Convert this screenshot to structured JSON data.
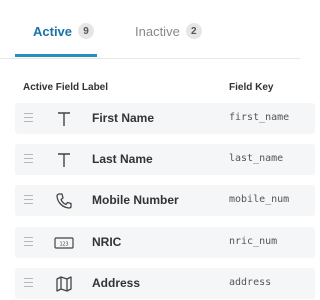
{
  "tabs": [
    {
      "label": "Active",
      "count": "9",
      "selected": true
    },
    {
      "label": "Inactive",
      "count": "2",
      "selected": false
    }
  ],
  "table": {
    "columns": {
      "label": "Active Field Label",
      "key": "Field Key"
    },
    "rows": [
      {
        "icon": "text-icon",
        "label": "First Name",
        "key": "first_name"
      },
      {
        "icon": "text-icon",
        "label": "Last Name",
        "key": "last_name"
      },
      {
        "icon": "phone-icon",
        "label": "Mobile Number",
        "key": "mobile_num"
      },
      {
        "icon": "id-card-icon",
        "label": "NRIC",
        "key": "nric_num"
      },
      {
        "icon": "map-icon",
        "label": "Address",
        "key": "address"
      }
    ]
  },
  "colors": {
    "accent": "#2a8fc0",
    "row_bg": "#f5f6f7"
  }
}
